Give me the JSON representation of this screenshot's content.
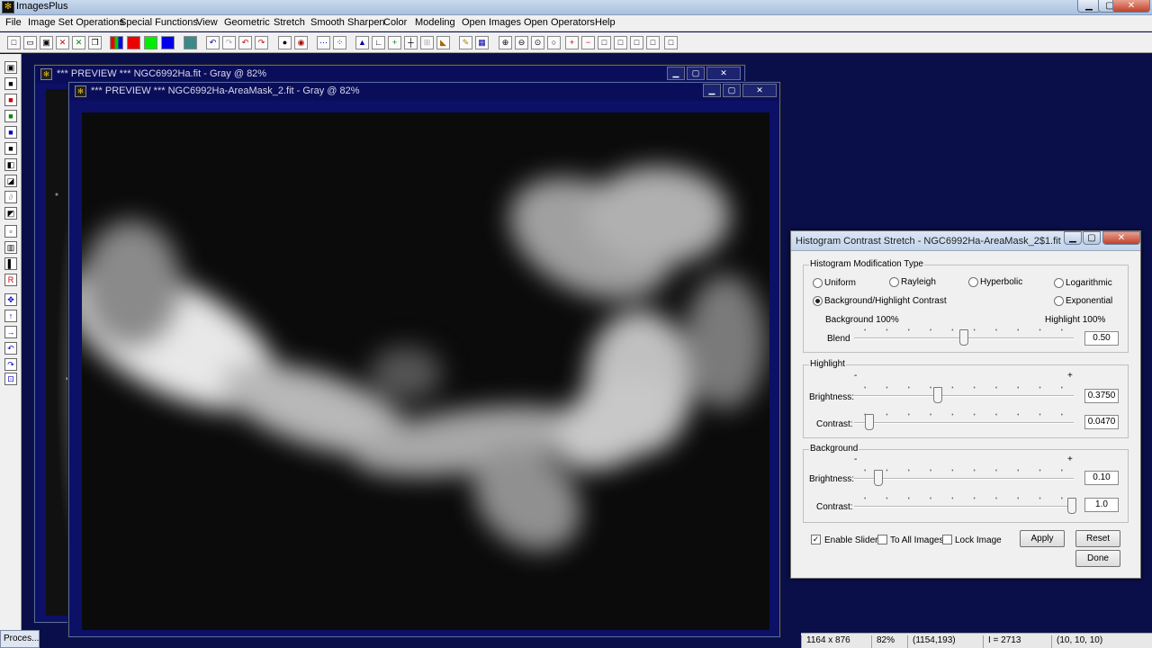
{
  "app": {
    "title": "ImagesPlus"
  },
  "menu": [
    "File",
    "Image Set Operations",
    "Special Functions",
    "View",
    "Geometric",
    "Stretch",
    "Smooth Sharpen",
    "Color",
    "Modeling",
    "Open Images",
    "Open Operators",
    "Help"
  ],
  "windows": {
    "back_title": "*** PREVIEW *** NGC6992Ha.fit - Gray @ 82%",
    "front_title": "*** PREVIEW *** NGC6992Ha-AreaMask_2.fit - Gray @ 82%"
  },
  "dialog": {
    "title": "Histogram Contrast Stretch - NGC6992Ha-AreaMask_2$1.fit",
    "modification": {
      "group_label": "Histogram Modification Type",
      "options": [
        "Uniform",
        "Rayleigh",
        "Hyperbolic",
        "Logarithmic",
        "Background/Highlight Contrast",
        "Exponential"
      ],
      "selected": "Background/Highlight Contrast",
      "bg_label": "Background 100%",
      "hl_label": "Highlight 100%",
      "blend_label": "Blend",
      "blend_value": "0.50"
    },
    "highlight": {
      "group_label": "Highlight",
      "minus": "-",
      "plus": "+",
      "brightness_label": "Brightness:",
      "brightness_value": "0.3750",
      "contrast_label": "Contrast:",
      "contrast_value": "0.0470"
    },
    "background": {
      "group_label": "Background",
      "minus": "-",
      "plus": "+",
      "brightness_label": "Brightness:",
      "brightness_value": "0.10",
      "contrast_label": "Contrast:",
      "contrast_value": "1.0"
    },
    "checkboxes": {
      "enable_slider": "Enable Slider",
      "to_all_images": "To All Images",
      "lock_image": "Lock Image"
    },
    "buttons": {
      "apply": "Apply",
      "reset": "Reset",
      "done": "Done"
    }
  },
  "status": {
    "dimensions": "1164 x 876",
    "zoom": "82%",
    "coords": "(1154,193)",
    "intensity": "I = 2713",
    "rgb": "(10, 10, 10)"
  },
  "taskbar": {
    "item": "Proces..."
  },
  "colors": {
    "desktop": "#0a0f4a",
    "window_frame": "#0c1066",
    "dialog_bg": "#f0f0f0"
  }
}
